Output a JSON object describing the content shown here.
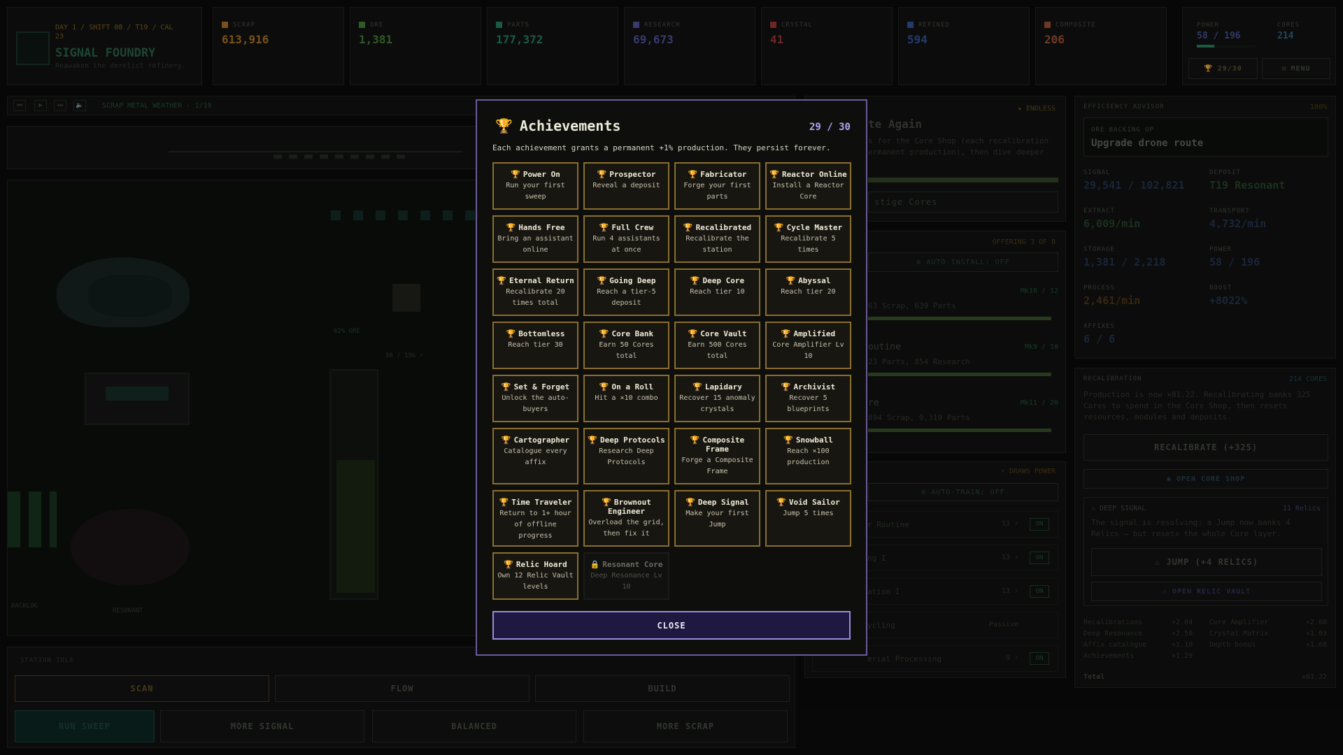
{
  "header": {
    "day_line": "DAY 1 / SHIFT 08 / T19 / CAL",
    "day_line2": "23",
    "title": "SIGNAL FOUNDRY",
    "subtitle": "Reawaken the derelict refinery."
  },
  "resources": [
    {
      "label": "SCRAP",
      "value": "613,916",
      "color": "#b97f2a"
    },
    {
      "label": "ORE",
      "value": "1,381",
      "color": "#4a8a3a"
    },
    {
      "label": "PARTS",
      "value": "177,372",
      "color": "#2a8a6a"
    },
    {
      "label": "RESEARCH",
      "value": "69,673",
      "color": "#5a5aaa"
    },
    {
      "label": "CRYSTAL",
      "value": "41",
      "color": "#aa3a3a"
    },
    {
      "label": "REFINED",
      "value": "594",
      "color": "#3a5aaa"
    },
    {
      "label": "COMPOSITE",
      "value": "206",
      "color": "#aa5a3a"
    }
  ],
  "power": {
    "label": "POWER",
    "value": "58 / 196",
    "fill": 0.3
  },
  "cores": {
    "label": "CORES",
    "value": "214"
  },
  "top_buttons": {
    "achievements": "29/30",
    "menu": "MENU"
  },
  "playback": {
    "track": "SCRAP METAL WEATHER · 1/19"
  },
  "map": {
    "ore_label": "62% ORE",
    "power_label": "58 / 196 ⚡",
    "backlog": "BACKLOG",
    "resonant": "RESONANT"
  },
  "station": {
    "status": "STATION IDLE",
    "tabs": [
      "SCAN",
      "FLOW",
      "BUILD"
    ],
    "actions": [
      "RUN SWEEP",
      "MORE SIGNAL",
      "BALANCED",
      "MORE SCRAP"
    ]
  },
  "middle": {
    "title": "te Again",
    "endless": "★ ENDLESS",
    "desc1": "s for the Core Shop (each recalibration",
    "desc2": "ermanent production), then dive deeper",
    "prestige": "stige Cores",
    "offering": "OFFERING 3 OF 8",
    "auto_install": "⚙ AUTO-INSTALL: OFF",
    "modules": [
      {
        "name": "",
        "mk": "Mk10 / 12",
        "cost": "63 Scrap, 639 Parts"
      },
      {
        "name": "outine",
        "mk": "Mk9 / 10",
        "cost": "23 Parts, 854 Research"
      },
      {
        "name": "re",
        "mk": "Mk11 / 20",
        "cost": "894 Scrap, 9,319 Parts"
      }
    ],
    "draws_power": "⚡ DRAWS POWER",
    "auto_train": "⚙ AUTO-TRAIN: OFF",
    "routines": [
      {
        "name": "r Routine",
        "cost": "13 ⚡",
        "state": "ON"
      },
      {
        "name": "ng I",
        "cost": "13 ⚡",
        "state": "ON"
      },
      {
        "name": "ation I",
        "cost": "13 ⚡",
        "state": "ON"
      },
      {
        "name": "ycling",
        "cost": "Passive",
        "state": ""
      },
      {
        "name": "erial Processing",
        "cost": "9 ⚡",
        "state": "ON"
      }
    ]
  },
  "advisor": {
    "title": "EFFICIENCY ADVISOR",
    "pct": "100%",
    "tip_label": "ORE BACKING UP",
    "tip": "Upgrade drone route",
    "stats": [
      {
        "label": "SIGNAL",
        "value": "29,541 / 102,821"
      },
      {
        "label": "DEPOSIT",
        "value": "T19 Resonant"
      },
      {
        "label": "EXTRACT",
        "value": "6,009/min"
      },
      {
        "label": "TRANSPORT",
        "value": "4,732/min"
      },
      {
        "label": "STORAGE",
        "value": "1,381 / 2,218"
      },
      {
        "label": "POWER",
        "value": "58 / 196"
      },
      {
        "label": "PROCESS",
        "value": "2,461/min"
      },
      {
        "label": "BOOST",
        "value": "+8022%"
      },
      {
        "label": "AFFIXES",
        "value": "6 / 6"
      }
    ]
  },
  "recal": {
    "title": "RECALIBRATION",
    "cores": "214 CORES",
    "text": "Production is now ×81.22. Recalibrating banks 325 Cores to spend in the Core Shop, then resets resources, modules and deposits.",
    "button": "RECALIBRATE (+325)",
    "shop": "◉ OPEN CORE SHOP",
    "deep_title": "⚠ DEEP SIGNAL",
    "relics": "11 Relics",
    "deep_text": "The signal is resolving: a Jump now banks 4 Relics — but resets the whole Core layer.",
    "jump": "⚠ JUMP (+4 RELICS)",
    "vault": "⚠ OPEN RELIC VAULT",
    "mults": [
      {
        "k": "Recalibrations",
        "v": "×2.04",
        "k2": "Core Amplifier",
        "v2": "×2.60"
      },
      {
        "k": "Deep Resonance",
        "v": "×2.50",
        "k2": "Crystal Matrix",
        "v2": "×1.03"
      },
      {
        "k": "Affix catalogue",
        "v": "×1.10",
        "k2": "Depth bonus",
        "v2": "×1.60"
      },
      {
        "k": "Achievements",
        "v": "×1.29",
        "k2": "",
        "v2": ""
      }
    ],
    "total_label": "Total",
    "total": "×81.22"
  },
  "modal": {
    "title": "Achievements",
    "count": "29 / 30",
    "subtitle": "Each achievement grants a permanent +1% production. They persist forever.",
    "close": "CLOSE",
    "achievements": [
      {
        "name": "Power On",
        "desc": "Run your first sweep",
        "unlocked": true
      },
      {
        "name": "Prospector",
        "desc": "Reveal a deposit",
        "unlocked": true
      },
      {
        "name": "Fabricator",
        "desc": "Forge your first parts",
        "unlocked": true
      },
      {
        "name": "Reactor Online",
        "desc": "Install a Reactor Core",
        "unlocked": true
      },
      {
        "name": "Hands Free",
        "desc": "Bring an assistant online",
        "unlocked": true
      },
      {
        "name": "Full Crew",
        "desc": "Run 4 assistants at once",
        "unlocked": true
      },
      {
        "name": "Recalibrated",
        "desc": "Recalibrate the station",
        "unlocked": true
      },
      {
        "name": "Cycle Master",
        "desc": "Recalibrate 5 times",
        "unlocked": true
      },
      {
        "name": "Eternal Return",
        "desc": "Recalibrate 20 times total",
        "unlocked": true
      },
      {
        "name": "Going Deep",
        "desc": "Reach a tier-5 deposit",
        "unlocked": true
      },
      {
        "name": "Deep Core",
        "desc": "Reach tier 10",
        "unlocked": true
      },
      {
        "name": "Abyssal",
        "desc": "Reach tier 20",
        "unlocked": true
      },
      {
        "name": "Bottomless",
        "desc": "Reach tier 30",
        "unlocked": true
      },
      {
        "name": "Core Bank",
        "desc": "Earn 50 Cores total",
        "unlocked": true
      },
      {
        "name": "Core Vault",
        "desc": "Earn 500 Cores total",
        "unlocked": true
      },
      {
        "name": "Amplified",
        "desc": "Core Amplifier Lv 10",
        "unlocked": true
      },
      {
        "name": "Set & Forget",
        "desc": "Unlock the auto-buyers",
        "unlocked": true
      },
      {
        "name": "On a Roll",
        "desc": "Hit a ×10 combo",
        "unlocked": true
      },
      {
        "name": "Lapidary",
        "desc": "Recover 15 anomaly crystals",
        "unlocked": true
      },
      {
        "name": "Archivist",
        "desc": "Recover 5 blueprints",
        "unlocked": true
      },
      {
        "name": "Cartographer",
        "desc": "Catalogue every affix",
        "unlocked": true
      },
      {
        "name": "Deep Protocols",
        "desc": "Research Deep Protocols",
        "unlocked": true
      },
      {
        "name": "Composite Frame",
        "desc": "Forge a Composite Frame",
        "unlocked": true
      },
      {
        "name": "Snowball",
        "desc": "Reach ×100 production",
        "unlocked": true
      },
      {
        "name": "Time Traveler",
        "desc": "Return to 1+ hour of offline progress",
        "unlocked": true
      },
      {
        "name": "Brownout Engineer",
        "desc": "Overload the grid, then fix it",
        "unlocked": true
      },
      {
        "name": "Deep Signal",
        "desc": "Make your first Jump",
        "unlocked": true
      },
      {
        "name": "Void Sailor",
        "desc": "Jump 5 times",
        "unlocked": true
      },
      {
        "name": "Relic Hoard",
        "desc": "Own 12 Relic Vault levels",
        "unlocked": true
      },
      {
        "name": "Resonant Core",
        "desc": "Deep Resonance Lv 10",
        "unlocked": false
      }
    ]
  },
  "colors": {
    "accent": "#9a8adf",
    "gold": "#8a6e2e",
    "trophy": "#e0a23a"
  }
}
